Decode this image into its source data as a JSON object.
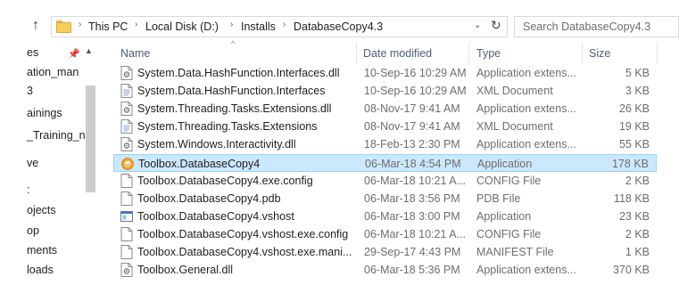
{
  "address": {
    "crumbs": [
      "This PC",
      "Local Disk (D:)",
      "Installs",
      "DatabaseCopy4.3"
    ],
    "search_placeholder": "Search DatabaseCopy4.3"
  },
  "nav": {
    "items": [
      "es",
      "ation_man",
      "3",
      "ainings",
      "_Training_n",
      "ve",
      ":",
      "ojects",
      "op",
      "ments",
      "loads"
    ]
  },
  "columns": {
    "name": "Name",
    "date": "Date modified",
    "type": "Type",
    "size": "Size"
  },
  "files": [
    {
      "name": "System.Data.HashFunction.Interfaces.dll",
      "date": "10-Sep-16 10:29 AM",
      "type": "Application extens...",
      "size": "5 KB",
      "icon": "dll-icon"
    },
    {
      "name": "System.Data.HashFunction.Interfaces",
      "date": "10-Sep-16 10:29 AM",
      "type": "XML Document",
      "size": "3 KB",
      "icon": "xml-icon"
    },
    {
      "name": "System.Threading.Tasks.Extensions.dll",
      "date": "08-Nov-17 9:41 AM",
      "type": "Application extens...",
      "size": "26 KB",
      "icon": "dll-icon"
    },
    {
      "name": "System.Threading.Tasks.Extensions",
      "date": "08-Nov-17 9:41 AM",
      "type": "XML Document",
      "size": "19 KB",
      "icon": "xml-icon"
    },
    {
      "name": "System.Windows.Interactivity.dll",
      "date": "18-Feb-13 2:30 PM",
      "type": "Application extens...",
      "size": "55 KB",
      "icon": "dll-icon"
    },
    {
      "name": "Toolbox.DatabaseCopy4",
      "date": "06-Mar-18 4:54 PM",
      "type": "Application",
      "size": "178 KB",
      "icon": "app-icon",
      "selected": true
    },
    {
      "name": "Toolbox.DatabaseCopy4.exe.config",
      "date": "06-Mar-18 10:21 A...",
      "type": "CONFIG File",
      "size": "2 KB",
      "icon": "file-icon"
    },
    {
      "name": "Toolbox.DatabaseCopy4.pdb",
      "date": "06-Mar-18 3:56 PM",
      "type": "PDB File",
      "size": "118 KB",
      "icon": "file-icon"
    },
    {
      "name": "Toolbox.DatabaseCopy4.vshost",
      "date": "06-Mar-18 3:00 PM",
      "type": "Application",
      "size": "23 KB",
      "icon": "exe-icon"
    },
    {
      "name": "Toolbox.DatabaseCopy4.vshost.exe.config",
      "date": "06-Mar-18 10:21 A...",
      "type": "CONFIG File",
      "size": "2 KB",
      "icon": "file-icon"
    },
    {
      "name": "Toolbox.DatabaseCopy4.vshost.exe.mani...",
      "date": "29-Sep-17 4:43 PM",
      "type": "MANIFEST File",
      "size": "1 KB",
      "icon": "file-icon"
    },
    {
      "name": "Toolbox.General.dll",
      "date": "06-Mar-18 5:36 PM",
      "type": "Application extens...",
      "size": "370 KB",
      "icon": "dll-icon"
    }
  ],
  "colors": {
    "selection_bg": "#cce8ff",
    "selection_border": "#99d1ff",
    "header_text": "#4c607a",
    "meta_text": "#6d6d6d"
  }
}
